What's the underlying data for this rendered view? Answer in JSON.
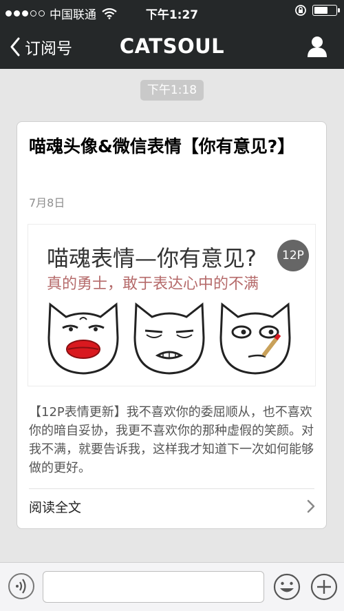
{
  "status_bar": {
    "carrier": "中国联通",
    "time": "下午1:27"
  },
  "nav": {
    "back_label": "订阅号",
    "title": "CATSOUL"
  },
  "chat": {
    "timestamp": "下午1:18"
  },
  "article": {
    "title": "喵魂头像&微信表情【你有意见?】",
    "date": "7月8日",
    "cover": {
      "title": "喵魂表情—你有意见?",
      "subtitle": "真的勇士，敢于表达心中的不满",
      "badge": "12P"
    },
    "summary": "【12P表情更新】我不喜欢你的委屈顺从，也不喜欢你的暗自妥协，我更不喜欢你的那种虚假的笑颜。对我不满，就要告诉我，这样我才知道下一次如何能够做的更好。",
    "read_more": "阅读全文"
  },
  "input_bar": {
    "placeholder": ""
  },
  "colors": {
    "bar": "#252829",
    "background": "#e6e6e6",
    "lips": "#d9191f"
  }
}
